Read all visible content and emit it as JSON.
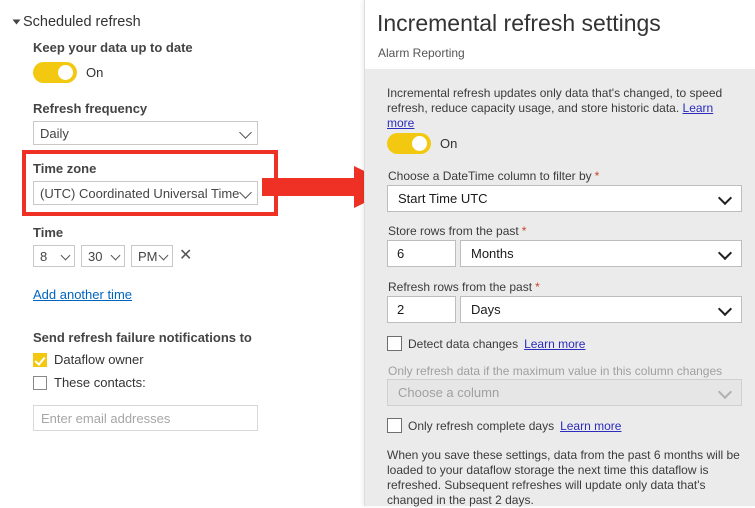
{
  "left": {
    "section_title": "Scheduled refresh",
    "keep_up_to_date_label": "Keep your data up to date",
    "keep_up_to_date_toggle": "On",
    "refresh_frequency_label": "Refresh frequency",
    "refresh_frequency_value": "Daily",
    "time_zone_label": "Time zone",
    "time_zone_value": "(UTC) Coordinated Universal Time",
    "time_label": "Time",
    "time_hour": "8",
    "time_minute": "30",
    "time_meridiem": "PM",
    "remove_time_icon": "✕",
    "add_another_time": "Add another time",
    "notifications_label": "Send refresh failure notifications to",
    "dataflow_owner_label": "Dataflow owner",
    "these_contacts_label": "These contacts:",
    "email_placeholder": "Enter email addresses"
  },
  "right": {
    "title": "Incremental refresh settings",
    "subtitle": "Alarm Reporting",
    "description": "Incremental refresh updates only data that's changed, to speed refresh, reduce capacity usage, and store historic data.",
    "description_link": "Learn more",
    "toggle_state": "On",
    "datetime_column_label": "Choose a DateTime column to filter by",
    "datetime_column_value": "Start Time UTC",
    "store_rows_label": "Store rows from the past",
    "store_rows_number": "6",
    "store_rows_unit": "Months",
    "refresh_rows_label": "Refresh rows from the past",
    "refresh_rows_number": "2",
    "refresh_rows_unit": "Days",
    "detect_changes_label": "Detect data changes",
    "detect_changes_link": "Learn more",
    "max_value_label": "Only refresh data if the maximum value in this column changes",
    "choose_column_placeholder": "Choose a column",
    "complete_days_label": "Only refresh complete days",
    "complete_days_link": "Learn more",
    "summary": "When you save these settings, data from the past 6 months will be loaded to your dataflow storage the next time this dataflow is refreshed. Subsequent refreshes will update only data that's changed in the past 2 days.",
    "required_marker": "*"
  },
  "annotation": {
    "highlight_color": "#ee3124",
    "arrow_color": "#ee3124"
  },
  "theme": {
    "accent_yellow": "#f2c811",
    "panel_gray": "#ebebeb",
    "link_blue": "#2b2bbd"
  }
}
